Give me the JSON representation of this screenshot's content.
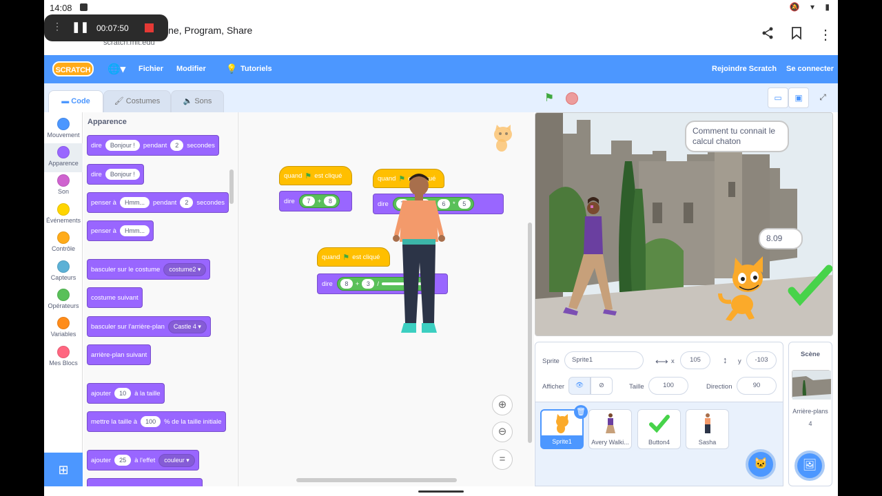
{
  "status": {
    "time": "14:08"
  },
  "browser": {
    "title": "Scratch - Imagine, Program, Share",
    "url": "scratch.mit.edu",
    "recording_time": "00:07:50"
  },
  "menu": {
    "logo": "SCRATCH",
    "file": "Fichier",
    "edit": "Modifier",
    "tutorials": "Tutoriels",
    "join": "Rejoindre Scratch",
    "signin": "Se connecter"
  },
  "tabs": {
    "code": "Code",
    "costumes": "Costumes",
    "sounds": "Sons"
  },
  "categories": [
    {
      "label": "Mouvement",
      "color": "#4c97ff"
    },
    {
      "label": "Apparence",
      "color": "#9966ff"
    },
    {
      "label": "Son",
      "color": "#cf63cf"
    },
    {
      "label": "Événements",
      "color": "#ffd500"
    },
    {
      "label": "Contrôle",
      "color": "#ffab19"
    },
    {
      "label": "Capteurs",
      "color": "#5cb1d6"
    },
    {
      "label": "Opérateurs",
      "color": "#59c059"
    },
    {
      "label": "Variables",
      "color": "#ff8c1a"
    },
    {
      "label": "Mes Blocs",
      "color": "#ff6680"
    }
  ],
  "palette": {
    "heading": "Apparence",
    "b1": {
      "say": "dire",
      "msg": "Bonjour !",
      "for": "pendant",
      "secs": "2",
      "unit": "secondes"
    },
    "b2": {
      "say": "dire",
      "msg": "Bonjour !"
    },
    "b3": {
      "think": "penser à",
      "msg": "Hmm...",
      "for": "pendant",
      "secs": "2",
      "unit": "secondes"
    },
    "b4": {
      "think": "penser à",
      "msg": "Hmm..."
    },
    "b5": {
      "label": "basculer sur le costume",
      "value": "costume2"
    },
    "b6": {
      "label": "costume suivant"
    },
    "b7": {
      "label": "basculer sur l'arrière-plan",
      "value": "Castle 4"
    },
    "b8": {
      "label": "arrière-plan suivant"
    },
    "b9": {
      "pre": "ajouter",
      "value": "10",
      "post": "à la taille"
    },
    "b10": {
      "pre": "mettre la taille à",
      "value": "100",
      "post": "% de la taille initiale"
    },
    "b11": {
      "pre": "ajouter",
      "value": "25",
      "post": "à l'effet",
      "effect": "couleur"
    }
  },
  "scripts": {
    "when": "quand",
    "clicked": "est cliqué",
    "say": "dire",
    "s1": {
      "a": "7",
      "op": "+",
      "b": "8"
    },
    "s2": {
      "a": "7",
      "op1": "+",
      "b": "3",
      "op2": "/",
      "c": "6",
      "op3": "*",
      "d": "5"
    },
    "s3": {
      "a": "8",
      "op1": "+",
      "b": "3",
      "op2": "/"
    }
  },
  "stage": {
    "bubble1": "Comment tu connait le calcul chaton",
    "bubble2": "8.09"
  },
  "sprite_info": {
    "sprite_label": "Sprite",
    "sprite_name": "Sprite1",
    "x_label": "x",
    "x": "105",
    "y_label": "y",
    "y": "-103",
    "show_label": "Afficher",
    "size_label": "Taille",
    "size": "100",
    "direction_label": "Direction",
    "direction": "90"
  },
  "sprites": [
    {
      "name": "Sprite1"
    },
    {
      "name": "Avery Walki..."
    },
    {
      "name": "Button4"
    },
    {
      "name": "Sasha"
    }
  ],
  "stage_pane": {
    "title": "Scène",
    "backdrops_label": "Arrière-plans",
    "backdrops_count": "4"
  },
  "colors": {
    "scratch_blue": "#4c97ff",
    "looks": "#9966ff",
    "events": "#ffbf00",
    "operators": "#59c059"
  }
}
